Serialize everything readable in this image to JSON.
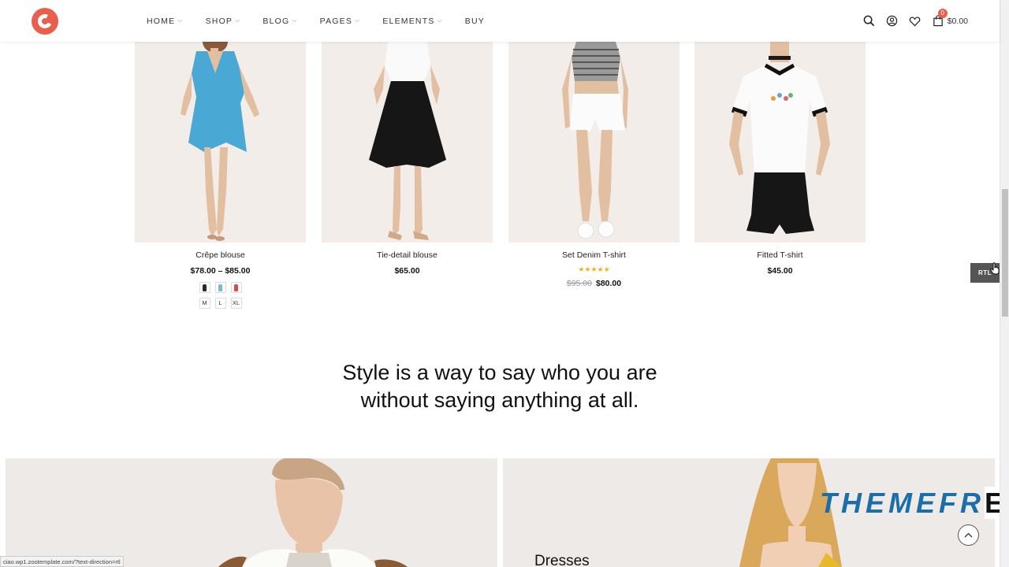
{
  "nav": {
    "items": [
      {
        "label": "HOME"
      },
      {
        "label": "SHOP"
      },
      {
        "label": "BLOG"
      },
      {
        "label": "PAGES"
      },
      {
        "label": "ELEMENTS"
      },
      {
        "label": "BUY"
      }
    ]
  },
  "cart": {
    "count": "0",
    "total": "$0.00"
  },
  "icons": {
    "search": "search-icon",
    "account": "user-icon",
    "wishlist": "heart-icon",
    "cart": "shopping-bag-icon"
  },
  "products": [
    {
      "name": "Crêpe blouse",
      "price": "$78.00 – $85.00",
      "colors": [
        "#2a2a2a",
        "#7fb8d4",
        "#d94b4b"
      ],
      "sizes": [
        "M",
        "L",
        "XL"
      ]
    },
    {
      "name": "Tie-detail blouse",
      "price": "$65.00"
    },
    {
      "name": "Set Denim T-shirt",
      "rating": "★★★★★",
      "old_price": "$95.00",
      "price": "$80.00"
    },
    {
      "name": "Fitted T-shirt",
      "price": "$45.00"
    }
  ],
  "rtl": {
    "label": "RTL"
  },
  "quote": {
    "part1": "Style is a way to say ",
    "highlight": "who you are",
    "line2": "without saying anything at all."
  },
  "banners": {
    "left_title": "",
    "right_title": "Dresses"
  },
  "watermark": {
    "text": "THEMEFR",
    "last": "E"
  },
  "status_url": "ciao.wp1.zootemplate.com/?text-direction=rtl",
  "colors": {
    "accent": "#e8604c",
    "highlight": "#ffd84a",
    "star": "#f2b01e"
  }
}
